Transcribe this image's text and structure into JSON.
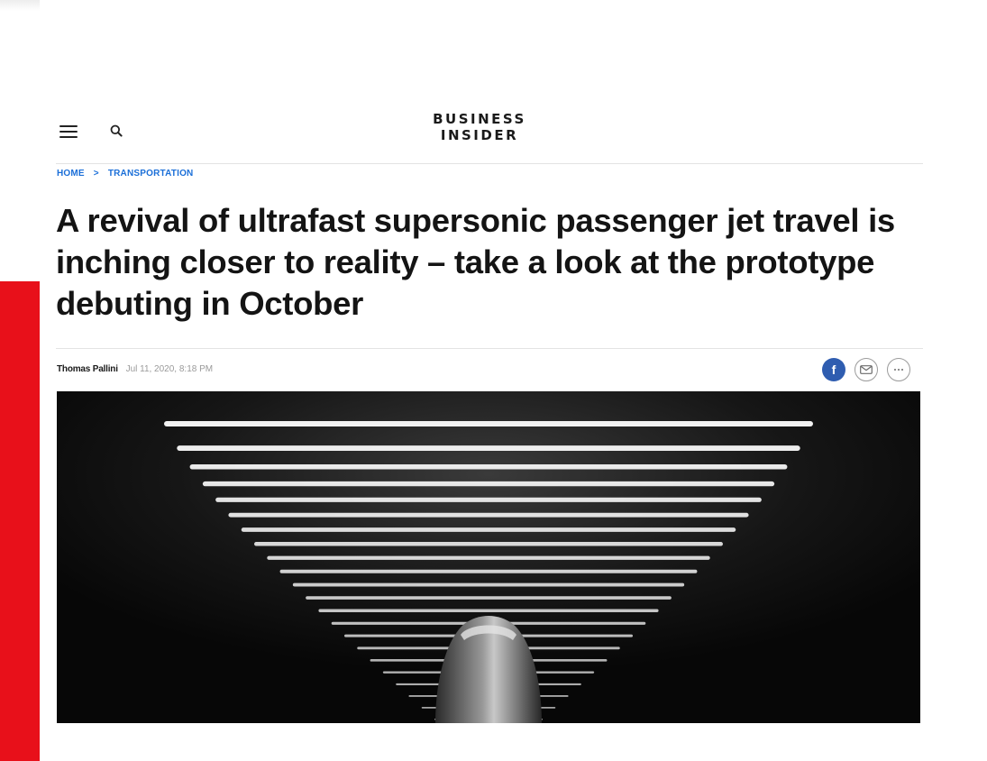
{
  "header": {
    "logo_line1": "BUSINESS",
    "logo_line2": "INSIDER",
    "menu_icon": "hamburger-menu-icon",
    "search_icon": "search-icon"
  },
  "breadcrumb": {
    "home": "HOME",
    "separator": ">",
    "section": "TRANSPORTATION"
  },
  "article": {
    "headline": "A revival of ultrafast supersonic passenger jet travel is inching closer to reality – take a look at the prototype debuting in October",
    "author": "Thomas Pallini",
    "timestamp": "Jul 11, 2020, 8:18 PM"
  },
  "share": {
    "facebook_glyph": "f",
    "facebook_icon": "facebook-icon",
    "email_icon": "email-icon",
    "more_icon": "more-options-icon"
  },
  "hero": {
    "image_subject": "supersonic jet prototype nose under hangar ceiling lights"
  },
  "colors": {
    "link_blue": "#1b6fd8",
    "accent_red": "#e8101a",
    "facebook_blue": "#2f5db0",
    "headline_text": "#141414",
    "meta_gray": "#9a9a9a"
  }
}
